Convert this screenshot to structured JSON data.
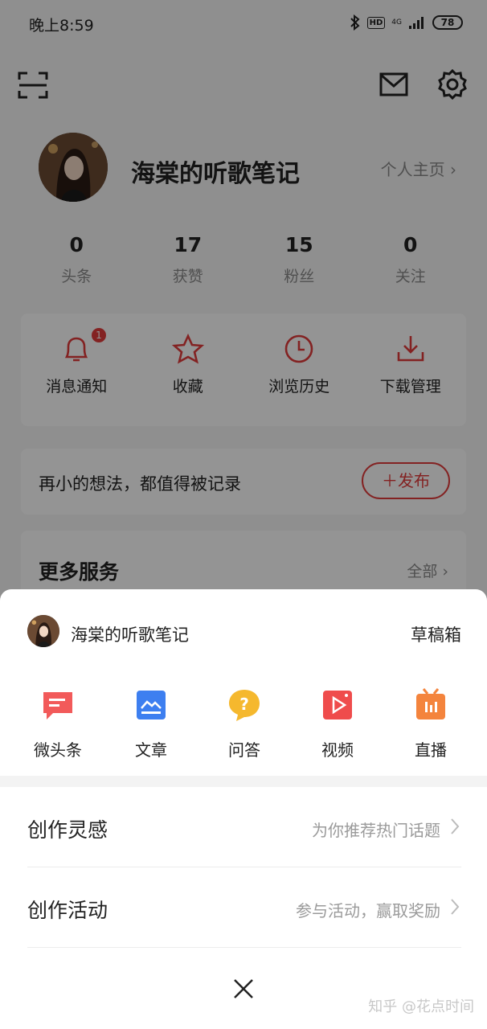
{
  "status_bar": {
    "time": "晚上8:59",
    "hd": "HD",
    "network": "4G",
    "battery": "78",
    "icons": [
      "bluetooth-icon",
      "hd-icon",
      "signal-icon",
      "battery-icon"
    ]
  },
  "top_bar": {
    "icons": [
      "scan-icon",
      "mail-icon",
      "settings-icon"
    ]
  },
  "profile": {
    "name": "海棠的听歌笔记",
    "link": "个人主页"
  },
  "stats": [
    {
      "value": "0",
      "label": "头条"
    },
    {
      "value": "17",
      "label": "获赞"
    },
    {
      "value": "15",
      "label": "粉丝"
    },
    {
      "value": "0",
      "label": "关注"
    }
  ],
  "quick_actions": [
    {
      "label": "消息通知",
      "icon": "bell-icon",
      "badge": "1"
    },
    {
      "label": "收藏",
      "icon": "star-icon"
    },
    {
      "label": "浏览历史",
      "icon": "clock-icon"
    },
    {
      "label": "下载管理",
      "icon": "download-icon"
    }
  ],
  "compose": {
    "prompt": "再小的想法，都值得被记录",
    "button": "＋发布"
  },
  "services": {
    "title": "更多服务",
    "all": "全部"
  },
  "sheet": {
    "user_name": "海棠的听歌笔记",
    "drafts": "草稿箱",
    "create_items": [
      {
        "label": "微头条",
        "icon": "micro-post-icon",
        "color": "#f25a5a"
      },
      {
        "label": "文章",
        "icon": "article-icon",
        "color": "#3d7ff0"
      },
      {
        "label": "问答",
        "icon": "question-icon",
        "color": "#f5b82e"
      },
      {
        "label": "视频",
        "icon": "video-icon",
        "color": "#ef4c4c"
      },
      {
        "label": "直播",
        "icon": "live-icon",
        "color": "#f4843d"
      }
    ],
    "rows": [
      {
        "title": "创作灵感",
        "desc": "为你推荐热门话题"
      },
      {
        "title": "创作活动",
        "desc": "参与活动，赢取奖励"
      }
    ]
  },
  "watermark": "知乎 @花点时间",
  "colors": {
    "accent_red": "#e23c3c",
    "overlay": "rgba(0,0,0,0.42)"
  }
}
